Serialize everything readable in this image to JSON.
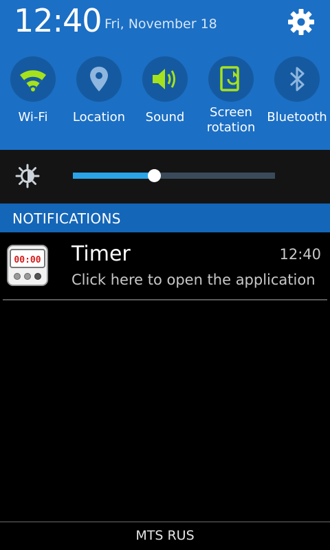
{
  "status": {
    "time": "12:40",
    "date": "Fri, November 18"
  },
  "icons": {
    "settings": "gear-icon",
    "brightness": "sun-icon"
  },
  "quick_settings": [
    {
      "label": "Wi-Fi",
      "icon": "wifi-icon",
      "active": true
    },
    {
      "label": "Location",
      "icon": "location-pin-icon",
      "active": false
    },
    {
      "label": "Sound",
      "icon": "speaker-icon",
      "active": true
    },
    {
      "label": "Screen\nrotation",
      "icon": "screen-rotation-icon",
      "active": true
    },
    {
      "label": "Bluetooth",
      "icon": "bluetooth-icon",
      "active": false
    }
  ],
  "brightness": {
    "level_percent": 40
  },
  "notifications": {
    "header": "NOTIFICATIONS",
    "items": [
      {
        "title": "Timer",
        "text": "Click here to open the application",
        "time": "12:40",
        "icon": "timer-app-icon",
        "icon_text": "00:00"
      }
    ]
  },
  "carrier": "MTS RUS",
  "colors": {
    "panel_blue": "#1b6fc4",
    "active_green": "#a6e21b",
    "inactive_icon": "#8fb6de",
    "slider_fill": "#2ba3e8"
  }
}
